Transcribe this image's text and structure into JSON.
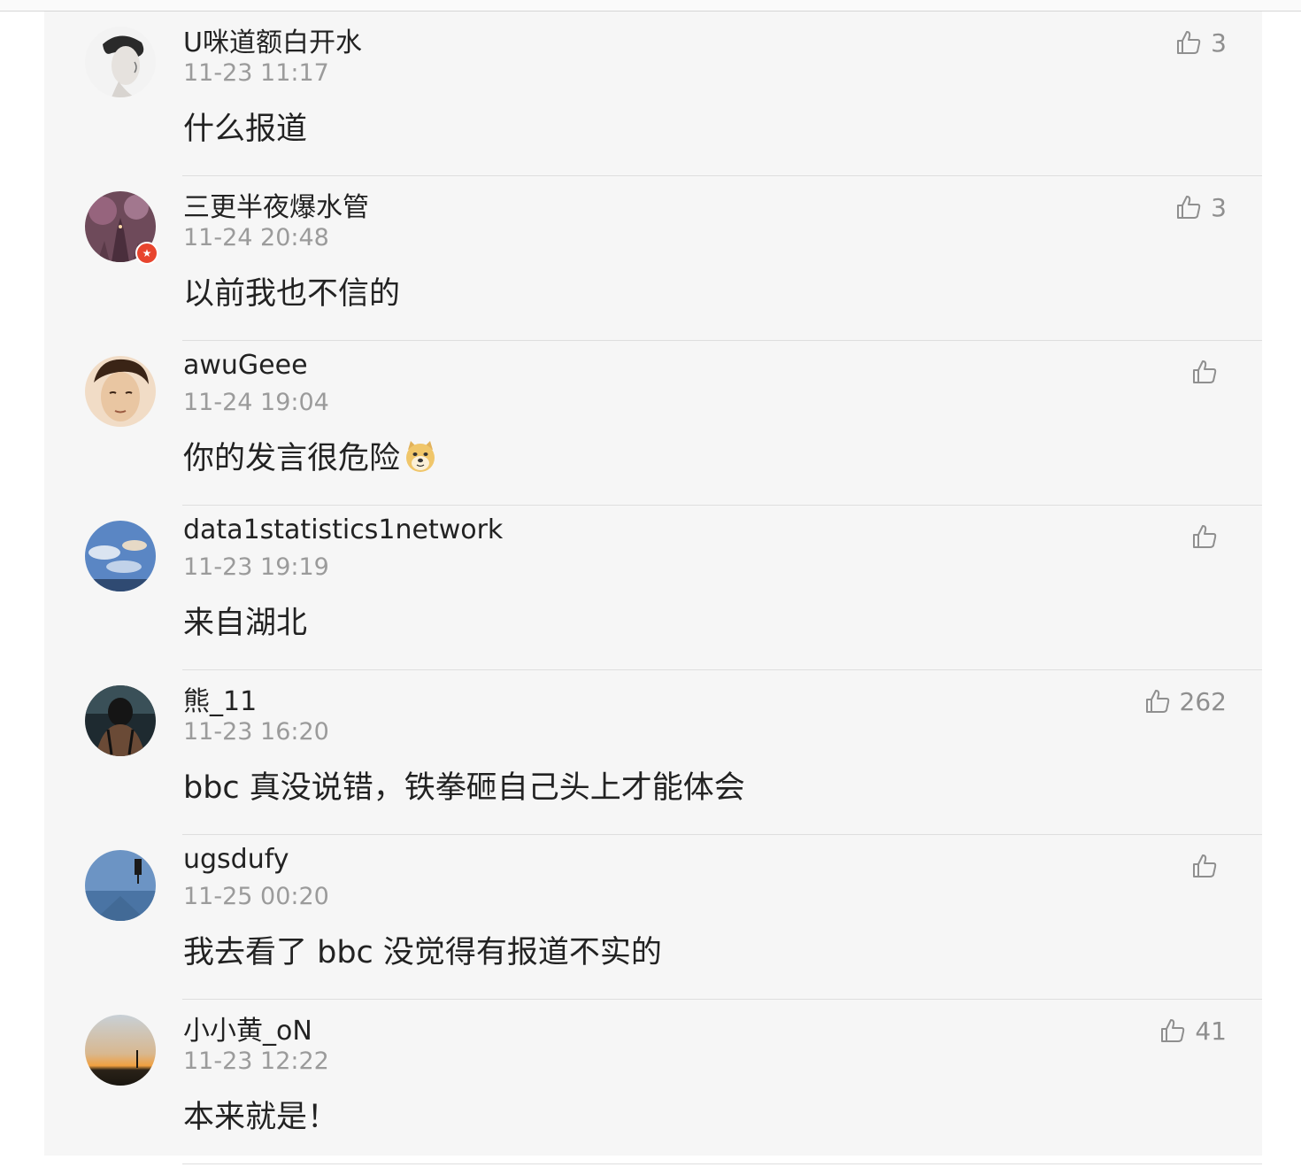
{
  "comments": [
    {
      "username": "U咪道额白开水",
      "time": "11-23 11:17",
      "content": "什么报道",
      "likes": "3",
      "avatar": "portrait-bw-avatar",
      "vip": false
    },
    {
      "username": "三更半夜爆水管",
      "time": "11-24 20:48",
      "content": "以前我也不信的",
      "likes": "3",
      "avatar": "castle-fireworks-avatar",
      "vip": true
    },
    {
      "username": "awuGeee",
      "time": "11-24 19:04",
      "content": "你的发言很危险",
      "likes": "",
      "avatar": "drawn-face-avatar",
      "vip": false,
      "emoji": "doge-emoji"
    },
    {
      "username": "data1statistics1network",
      "time": "11-23 19:19",
      "content": "来自湖北",
      "likes": "",
      "avatar": "sky-clouds-avatar",
      "vip": false
    },
    {
      "username": "熊_11",
      "time": "11-23 16:20",
      "content": "bbc 真没说错，铁拳砸自己头上才能体会",
      "likes": "262",
      "avatar": "dark-figure-avatar",
      "vip": false
    },
    {
      "username": "ugsdufy",
      "time": "11-25 00:20",
      "content": "我去看了 bbc 没觉得有报道不实的",
      "likes": "",
      "avatar": "blue-sky-avatar",
      "vip": false
    },
    {
      "username": "小小黄_oN",
      "time": "11-23 12:22",
      "content": "本来就是！",
      "likes": "41",
      "avatar": "sunset-avatar",
      "vip": false
    }
  ],
  "icons": {
    "like": "thumbs-up-icon",
    "vip": "vip-badge-icon"
  },
  "colors": {
    "panel": "#f6f6f6",
    "text": "#222222",
    "meta": "#9b9b9b",
    "like": "#8f8f8f",
    "badge": "#e8452e"
  }
}
